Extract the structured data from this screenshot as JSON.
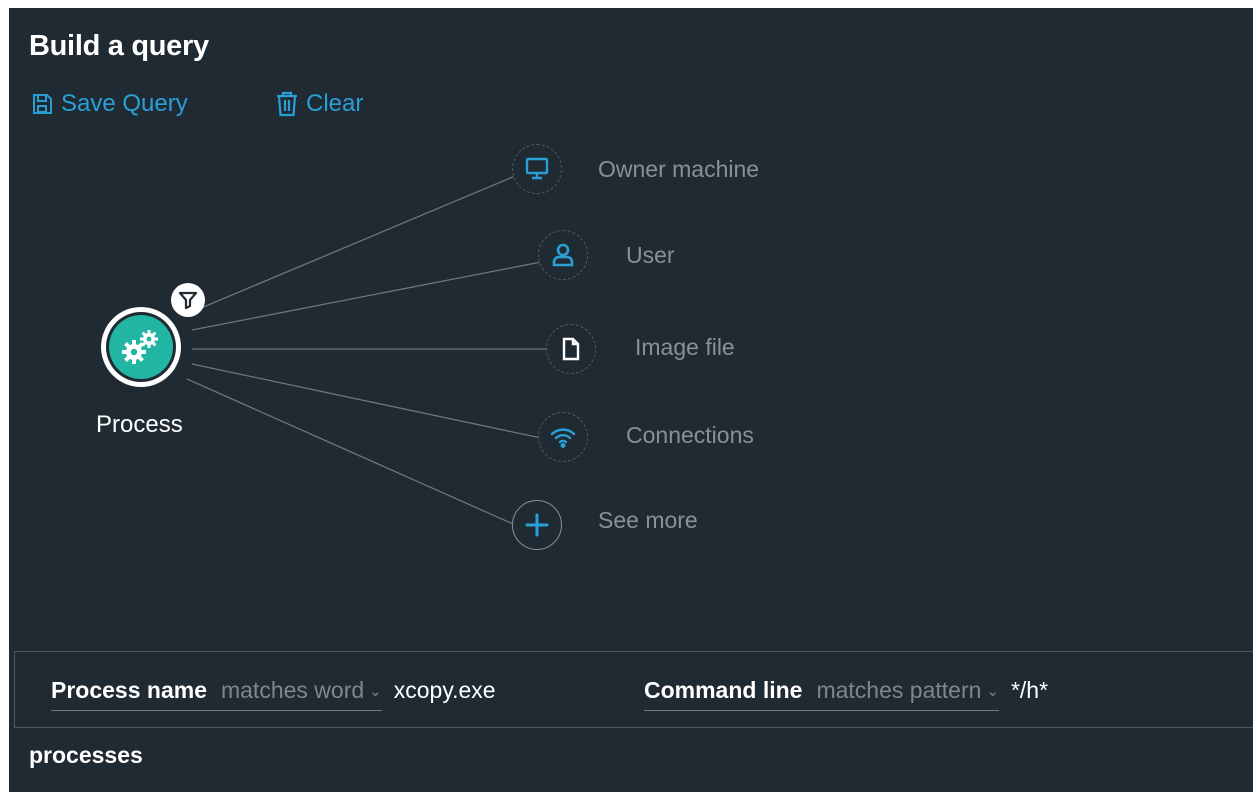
{
  "header": {
    "title": "Build a query"
  },
  "toolbar": {
    "save_label": "Save Query",
    "clear_label": "Clear",
    "save_icon": "floppy-disk-icon",
    "clear_icon": "trash-icon"
  },
  "graph": {
    "center": {
      "label": "Process",
      "icon": "gears-icon",
      "badge_icon": "filter-icon"
    },
    "nodes": [
      {
        "label": "Owner machine",
        "icon": "monitor-icon"
      },
      {
        "label": "User",
        "icon": "user-icon"
      },
      {
        "label": "Image file",
        "icon": "file-icon"
      },
      {
        "label": "Connections",
        "icon": "wifi-icon"
      },
      {
        "label": "See more",
        "icon": "plus-icon"
      }
    ]
  },
  "filters": [
    {
      "field": "Process name",
      "operator": "matches word",
      "value": "xcopy.exe"
    },
    {
      "field": "Command line",
      "operator": "matches pattern",
      "value": "*/h*"
    }
  ],
  "result": {
    "label": "processes"
  },
  "colors": {
    "background": "#1f2a33",
    "accent": "#2a9fd6",
    "process_fill": "#21b5a3",
    "muted_text": "#8a9196"
  }
}
